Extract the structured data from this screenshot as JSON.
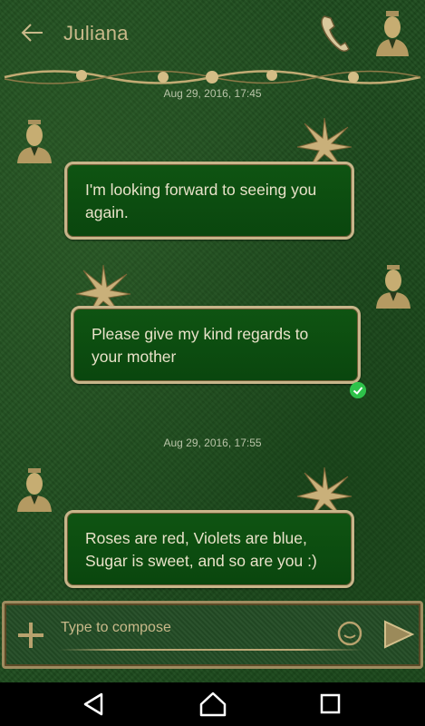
{
  "header": {
    "contact_name": "Juliana"
  },
  "conversation": [
    {
      "type": "timestamp",
      "text": "Aug 29, 2016, 17:45"
    },
    {
      "type": "message",
      "direction": "incoming",
      "text": "I'm looking forward to seeing you again."
    },
    {
      "type": "message",
      "direction": "outgoing",
      "text": "Please give my kind regards to your mother",
      "status": "delivered"
    },
    {
      "type": "timestamp",
      "text": "Aug 29, 2016, 17:55"
    },
    {
      "type": "message",
      "direction": "incoming",
      "text": "Roses are red, Violets are blue, Sugar is sweet, and so are you :)"
    }
  ],
  "compose": {
    "placeholder": "Type to compose"
  },
  "icons": {
    "back": "arrow-left-icon",
    "call": "phone-icon",
    "contact": "contact-avatar-icon",
    "add": "plus-icon",
    "emoji": "smiley-icon",
    "send": "send-arrow-icon",
    "nav_back": "triangle-back-icon",
    "nav_home": "home-icon",
    "nav_recent": "square-recents-icon"
  },
  "colors": {
    "background": "#1f4d1f",
    "bubble_fill": "#0f5412",
    "gold_accent": "#c8b58a",
    "text": "#e9e2c9",
    "delivered_check": "#2ec24a"
  }
}
